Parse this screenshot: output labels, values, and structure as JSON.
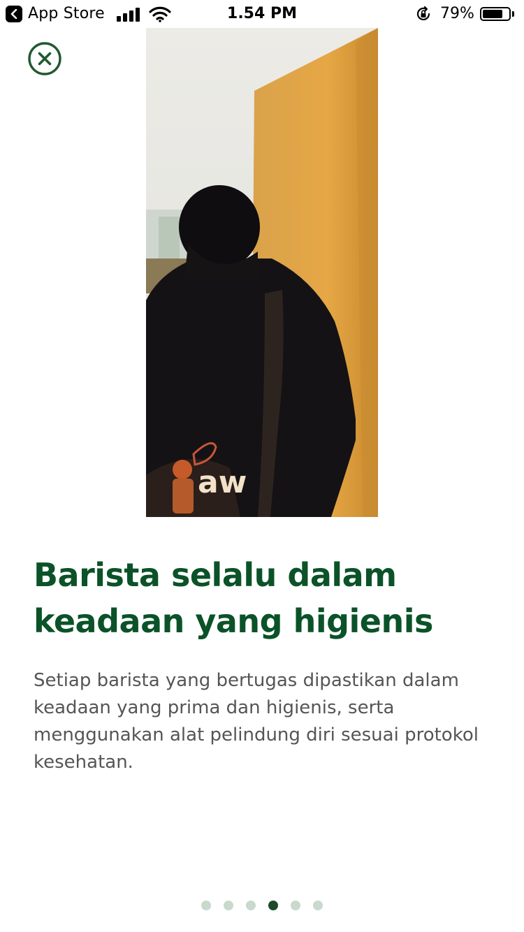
{
  "status_bar": {
    "back_label": "App Store",
    "time": "1.54 PM",
    "battery_percent": "79%",
    "battery_level": 0.79
  },
  "close_button": {
    "icon": "close-circle-icon",
    "color": "#1f5a2f"
  },
  "slide": {
    "title": "Barista selalu dalam keadaan yang higienis",
    "description": "Setiap barista yang bertugas dipastikan dalam keadaan yang prima dan higienis, serta menggunakan alat pelindung diri sesuai protokol kesehatan."
  },
  "pagination": {
    "total": 6,
    "current": 4
  },
  "colors": {
    "title": "#0b5228",
    "body_text": "#555555",
    "dot_active": "#1c4a2a",
    "dot_inactive": "#c9d9cc"
  }
}
